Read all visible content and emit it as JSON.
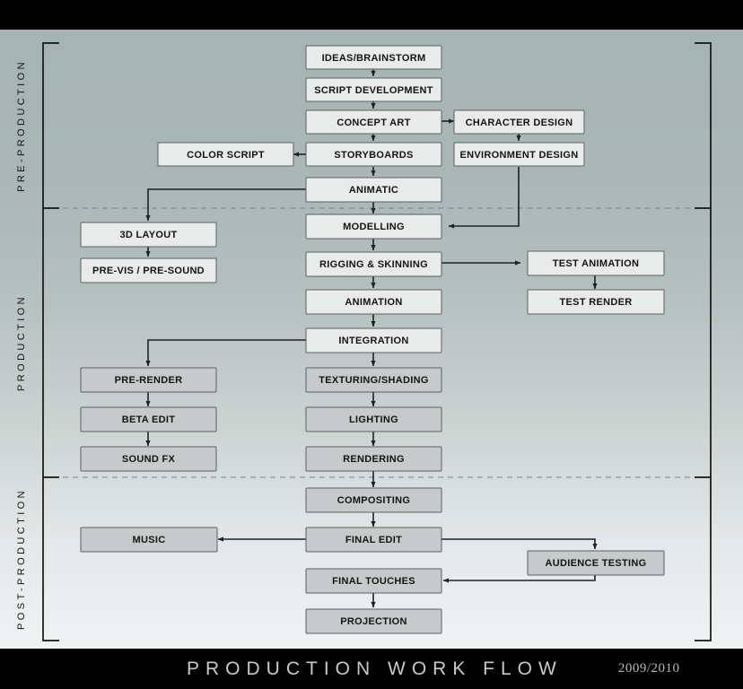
{
  "footer": {
    "title": "PRODUCTION WORK FLOW",
    "year": "2009/2010"
  },
  "sections": [
    {
      "id": "pre-production",
      "label": "PRE-PRODUCTION"
    },
    {
      "id": "production",
      "label": "PRODUCTION"
    },
    {
      "id": "post-production",
      "label": "POST-PRODUCTION"
    }
  ],
  "chart_data": {
    "type": "diagram",
    "title": "PRODUCTION WORK FLOW",
    "subtitle": "2009/2010",
    "columns": [
      "left",
      "center",
      "right"
    ],
    "phases": [
      "PRE-PRODUCTION",
      "PRODUCTION",
      "POST-PRODUCTION"
    ],
    "nodes": [
      {
        "id": "ideas",
        "label": "IDEAS/BRAINSTORM",
        "phase": "PRE-PRODUCTION",
        "column": "center"
      },
      {
        "id": "script",
        "label": "SCRIPT DEVELOPMENT",
        "phase": "PRE-PRODUCTION",
        "column": "center"
      },
      {
        "id": "concept",
        "label": "CONCEPT ART",
        "phase": "PRE-PRODUCTION",
        "column": "center"
      },
      {
        "id": "character",
        "label": "CHARACTER DESIGN",
        "phase": "PRE-PRODUCTION",
        "column": "right"
      },
      {
        "id": "colorscript",
        "label": "COLOR SCRIPT",
        "phase": "PRE-PRODUCTION",
        "column": "left"
      },
      {
        "id": "storyboards",
        "label": "STORYBOARDS",
        "phase": "PRE-PRODUCTION",
        "column": "center"
      },
      {
        "id": "environment",
        "label": "ENVIRONMENT DESIGN",
        "phase": "PRE-PRODUCTION",
        "column": "right"
      },
      {
        "id": "animatic",
        "label": "ANIMATIC",
        "phase": "PRE-PRODUCTION",
        "column": "center"
      },
      {
        "id": "layout3d",
        "label": "3D LAYOUT",
        "phase": "PRODUCTION",
        "column": "left"
      },
      {
        "id": "modelling",
        "label": "MODELLING",
        "phase": "PRODUCTION",
        "column": "center"
      },
      {
        "id": "previs",
        "label": "PRE-VIS / PRE-SOUND",
        "phase": "PRODUCTION",
        "column": "left"
      },
      {
        "id": "rigging",
        "label": "RIGGING & SKINNING",
        "phase": "PRODUCTION",
        "column": "center"
      },
      {
        "id": "testanim",
        "label": "TEST ANIMATION",
        "phase": "PRODUCTION",
        "column": "right"
      },
      {
        "id": "animation",
        "label": "ANIMATION",
        "phase": "PRODUCTION",
        "column": "center"
      },
      {
        "id": "testrender",
        "label": "TEST RENDER",
        "phase": "PRODUCTION",
        "column": "right"
      },
      {
        "id": "integration",
        "label": "INTEGRATION",
        "phase": "PRODUCTION",
        "column": "center"
      },
      {
        "id": "prerender",
        "label": "PRE-RENDER",
        "phase": "PRODUCTION",
        "column": "left"
      },
      {
        "id": "texturing",
        "label": "TEXTURING/SHADING",
        "phase": "PRODUCTION",
        "column": "center"
      },
      {
        "id": "betaedit",
        "label": "BETA EDIT",
        "phase": "PRODUCTION",
        "column": "left"
      },
      {
        "id": "lighting",
        "label": "LIGHTING",
        "phase": "PRODUCTION",
        "column": "center"
      },
      {
        "id": "soundfx",
        "label": "SOUND FX",
        "phase": "PRODUCTION",
        "column": "left"
      },
      {
        "id": "rendering",
        "label": "RENDERING",
        "phase": "PRODUCTION",
        "column": "center"
      },
      {
        "id": "compositing",
        "label": "COMPOSITING",
        "phase": "POST-PRODUCTION",
        "column": "center"
      },
      {
        "id": "music",
        "label": "MUSIC",
        "phase": "POST-PRODUCTION",
        "column": "left"
      },
      {
        "id": "finaledit",
        "label": "FINAL EDIT",
        "phase": "POST-PRODUCTION",
        "column": "center"
      },
      {
        "id": "audience",
        "label": "AUDIENCE TESTING",
        "phase": "POST-PRODUCTION",
        "column": "right"
      },
      {
        "id": "finaltouches",
        "label": "FINAL TOUCHES",
        "phase": "POST-PRODUCTION",
        "column": "center"
      },
      {
        "id": "projection",
        "label": "PROJECTION",
        "phase": "POST-PRODUCTION",
        "column": "center"
      }
    ],
    "edges": [
      {
        "from": "ideas",
        "to": "script"
      },
      {
        "from": "script",
        "to": "concept"
      },
      {
        "from": "concept",
        "to": "character"
      },
      {
        "from": "concept",
        "to": "storyboards"
      },
      {
        "from": "storyboards",
        "to": "colorscript"
      },
      {
        "from": "character",
        "to": "environment"
      },
      {
        "from": "storyboards",
        "to": "animatic"
      },
      {
        "from": "animatic",
        "to": "layout3d"
      },
      {
        "from": "animatic",
        "to": "modelling"
      },
      {
        "from": "environment",
        "to": "modelling"
      },
      {
        "from": "layout3d",
        "to": "previs"
      },
      {
        "from": "modelling",
        "to": "rigging"
      },
      {
        "from": "rigging",
        "to": "testanim"
      },
      {
        "from": "rigging",
        "to": "animation"
      },
      {
        "from": "testanim",
        "to": "testrender"
      },
      {
        "from": "animation",
        "to": "integration"
      },
      {
        "from": "integration",
        "to": "prerender"
      },
      {
        "from": "integration",
        "to": "texturing"
      },
      {
        "from": "prerender",
        "to": "betaedit"
      },
      {
        "from": "texturing",
        "to": "lighting"
      },
      {
        "from": "betaedit",
        "to": "soundfx"
      },
      {
        "from": "lighting",
        "to": "rendering"
      },
      {
        "from": "rendering",
        "to": "compositing"
      },
      {
        "from": "compositing",
        "to": "finaledit"
      },
      {
        "from": "finaledit",
        "to": "music"
      },
      {
        "from": "finaledit",
        "to": "audience"
      },
      {
        "from": "audience",
        "to": "finaltouches"
      },
      {
        "from": "finaltouches",
        "to": "projection"
      }
    ]
  }
}
